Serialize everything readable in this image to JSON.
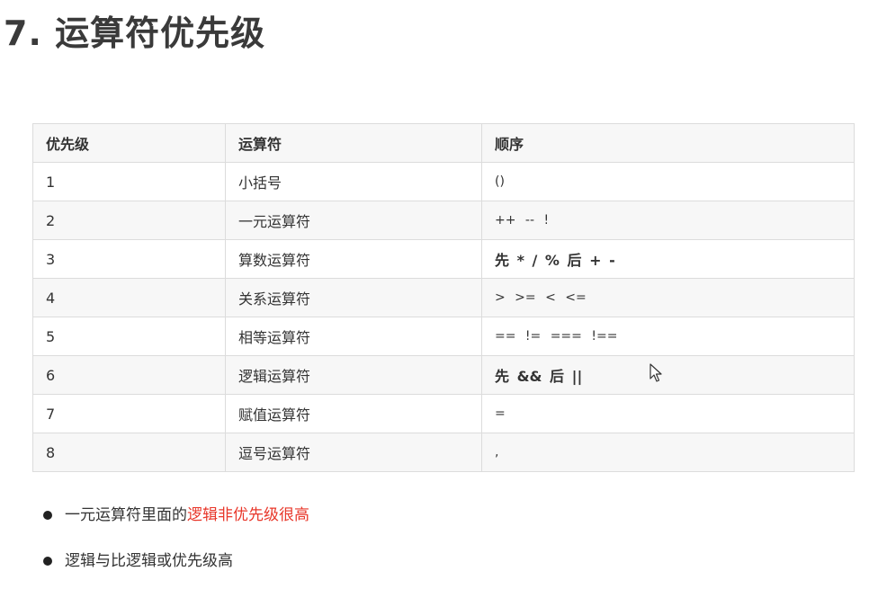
{
  "title": "7. 运算符优先级",
  "table": {
    "headers": [
      "优先级",
      "运算符",
      "顺序"
    ],
    "rows": [
      {
        "level": "1",
        "operator": "小括号",
        "order": "()",
        "bold": false
      },
      {
        "level": "2",
        "operator": "一元运算符",
        "order": "++ -- !",
        "bold": false
      },
      {
        "level": "3",
        "operator": "算数运算符",
        "order": "先 * / % 后 + -",
        "bold": true
      },
      {
        "level": "4",
        "operator": "关系运算符",
        "order": "> >= < <=",
        "bold": false
      },
      {
        "level": "5",
        "operator": "相等运算符",
        "order": "== != === !==",
        "bold": false
      },
      {
        "level": "6",
        "operator": "逻辑运算符",
        "order": "先 && 后 ||",
        "bold": true
      },
      {
        "level": "7",
        "operator": "赋值运算符",
        "order": "=",
        "bold": false
      },
      {
        "level": "8",
        "operator": "逗号运算符",
        "order": ",",
        "bold": false
      }
    ]
  },
  "notes": [
    {
      "prefix": "一元运算符里面的",
      "highlight": "逻辑非优先级很高",
      "highlight_color": "#e8372a"
    },
    {
      "prefix": "逻辑与比逻辑或优先级高",
      "highlight": ""
    }
  ],
  "icons": {
    "cursor": "mouse-pointer-icon",
    "bullet": "bullet-dot-icon"
  }
}
